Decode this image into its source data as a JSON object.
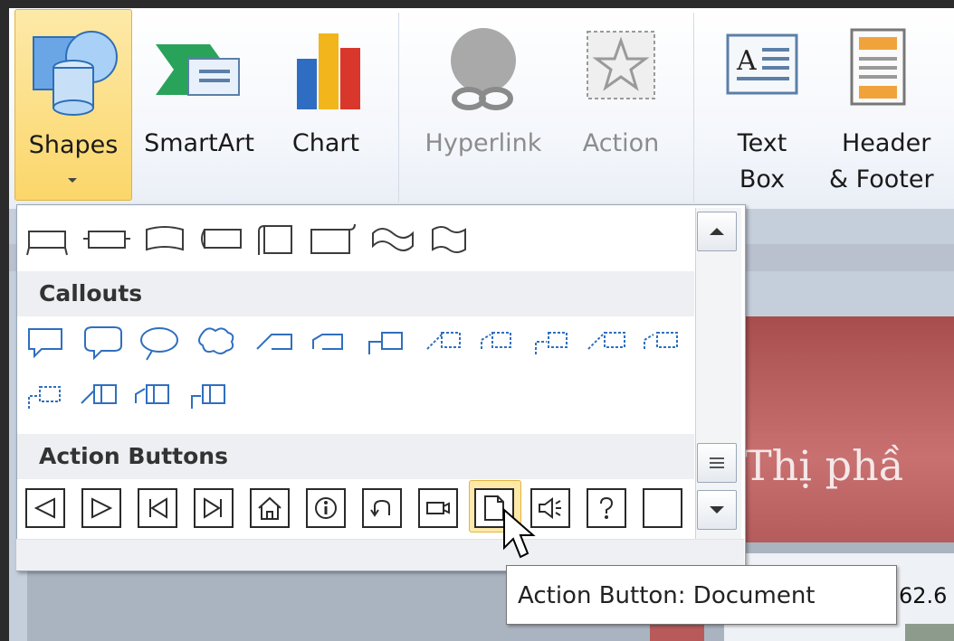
{
  "ribbon": {
    "shapes": "Shapes",
    "smartart": "SmartArt",
    "chart": "Chart",
    "hyperlink": "Hyperlink",
    "action": "Action",
    "textbox_l1": "Text",
    "textbox_l2": "Box",
    "header_l1": "Header",
    "header_l2": "& Footer"
  },
  "gallery": {
    "callouts_heading": "Callouts",
    "action_buttons_heading": "Action Buttons",
    "action_buttons": [
      "back-or-previous",
      "forward-or-next",
      "beginning",
      "end",
      "home",
      "information",
      "return",
      "movie",
      "document",
      "sound",
      "help",
      "custom"
    ],
    "selected_action_button": "document"
  },
  "tooltip": {
    "text": "Action Button: Document"
  },
  "slide": {
    "title_fragment": "Thị phầ",
    "value_fragment": "62.6"
  },
  "colors": {
    "highlight": "#fbd66a",
    "slide_red": "#b85a5a"
  }
}
